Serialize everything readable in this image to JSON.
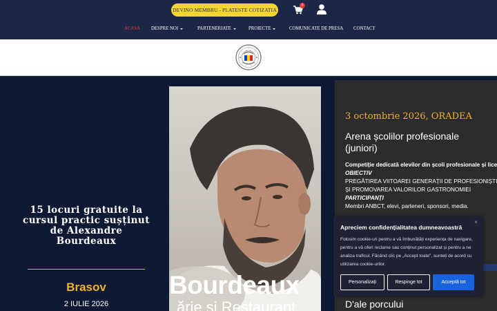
{
  "header": {
    "cta_label": "DEVINO MEMBRU - PLATESTE COTIZATIA",
    "cart_count": "0",
    "nav": [
      {
        "label": "ACASA",
        "active": true,
        "dropdown": false
      },
      {
        "label": "DESPRE NOI",
        "dropdown": true
      },
      {
        "label": "PARTENERIATE",
        "dropdown": true
      },
      {
        "label": "PROIECTE",
        "dropdown": true
      },
      {
        "label": "COMUNICATE DE PRESA",
        "dropdown": false
      },
      {
        "label": "CONTACT",
        "dropdown": false
      }
    ],
    "icons": {
      "cart": "cart-icon",
      "user": "user-icon",
      "logo": "anbct-logo"
    }
  },
  "promo": {
    "title": "15 locuri gratuite la cursul practic sușținut de Alexandre Bourdeaux",
    "city": "Brasov",
    "date": "2 IULIE 2026"
  },
  "photo": {
    "caption_main": "Bourdeaux",
    "caption_sub": "ărie și Restaurant"
  },
  "event": {
    "date": "3 octombrie 2026, ORADEA",
    "title": "Arena școlilor profesionale (juniori)",
    "intro": "Competiție dedicată elevilor din școli profesionale și licee tehnologice",
    "objective_label": "OBIECTIV",
    "objective_line1": "PREGĂTIREA VIITOAREI GENERAȚII DE PROFESIONIȘTI",
    "objective_line2": "ȘI PROMOVAREA VALORILOR GASTRONOMIEI",
    "participants_label": "PARTICIPANȚI",
    "participants": "Membri ANBCT, elevi, parteneri, sponsori, media."
  },
  "event2": {
    "title": "D'ale porcului"
  },
  "cookie": {
    "title": "Apreciem confidențialitatea dumneavoastră",
    "text": "Folosim cookie-uri pentru a vă îmbunătăți experiența de navigare, pentru a vă oferi reclame sau conținut personalizat și pentru a ne analiza traficul. Făcând clic pe „Accept toate”, sunteți de acord cu utilizarea cookie-urilor.",
    "btn_customize": "Personalizați",
    "btn_reject": "Respinge tot",
    "btn_accept": "Acceptă tot",
    "close": "×"
  },
  "colors": {
    "navy": "#1c2747",
    "yellow": "#f3d531",
    "accent_red": "#e53935",
    "gold": "#f3b22b",
    "accept_blue": "#1863dc"
  }
}
